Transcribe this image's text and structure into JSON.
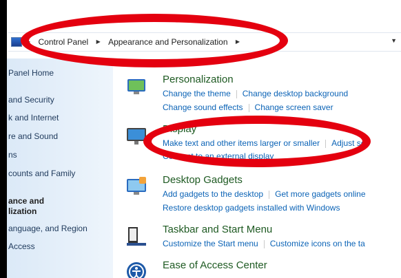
{
  "address_bar": {
    "breadcrumb": [
      "Control Panel",
      "Appearance and Personalization"
    ]
  },
  "sidebar": {
    "items": [
      "Panel Home",
      "and Security",
      "k and Internet",
      "re and Sound",
      "ns",
      "counts and Family",
      "ance and",
      "lization",
      "anguage, and Region",
      "Access"
    ]
  },
  "categories": [
    {
      "title": "Personalization",
      "icon": "personalization-icon",
      "line1": [
        "Change the theme",
        "Change desktop background"
      ],
      "line2": [
        "Change sound effects",
        "Change screen saver"
      ]
    },
    {
      "title": "Display",
      "icon": "display-icon",
      "line1": [
        "Make text and other items larger or smaller",
        "Adjust sc"
      ],
      "line2": [
        "Connect to an external display"
      ]
    },
    {
      "title": "Desktop Gadgets",
      "icon": "gadgets-icon",
      "line1": [
        "Add gadgets to the desktop",
        "Get more gadgets online"
      ],
      "line2": [
        "Restore desktop gadgets installed with Windows"
      ]
    },
    {
      "title": "Taskbar and Start Menu",
      "icon": "taskbar-icon",
      "line1": [
        "Customize the Start menu",
        "Customize icons on the ta"
      ]
    },
    {
      "title": "Ease of Access Center",
      "icon": "ease-of-access-icon"
    }
  ],
  "colors": {
    "link": "#0b63b6",
    "category_title": "#1e5a22",
    "annotation": "#e4000f"
  }
}
